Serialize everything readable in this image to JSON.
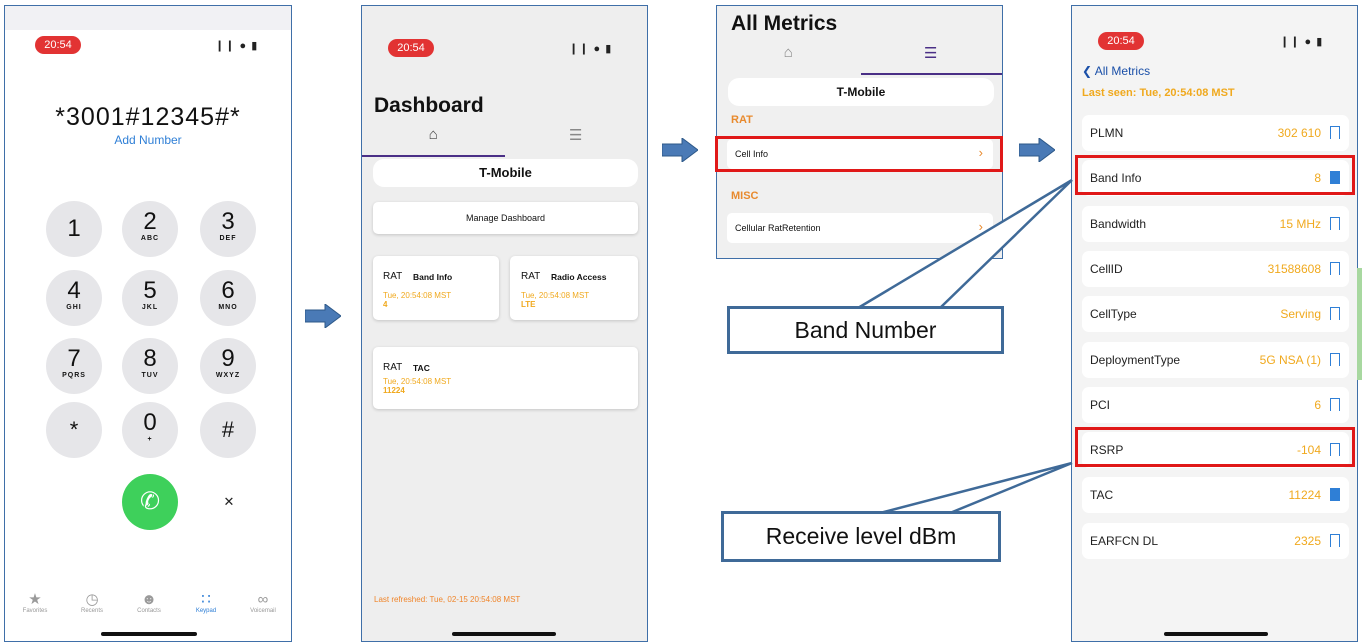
{
  "time": "20:54",
  "status_icons": "❙❙ ● ▮",
  "phone1": {
    "dialed": "*3001#12345#*",
    "add_number": "Add Number",
    "keys": [
      {
        "digit": "1",
        "letters": ""
      },
      {
        "digit": "2",
        "letters": "ABC"
      },
      {
        "digit": "3",
        "letters": "DEF"
      },
      {
        "digit": "4",
        "letters": "GHI"
      },
      {
        "digit": "5",
        "letters": "JKL"
      },
      {
        "digit": "6",
        "letters": "MNO"
      },
      {
        "digit": "7",
        "letters": "PQRS"
      },
      {
        "digit": "8",
        "letters": "TUV"
      },
      {
        "digit": "9",
        "letters": "WXYZ"
      },
      {
        "digit": "*",
        "letters": ""
      },
      {
        "digit": "0",
        "letters": "+"
      },
      {
        "digit": "#",
        "letters": ""
      }
    ],
    "tabs": [
      "Favorites",
      "Recents",
      "Contacts",
      "Keypad",
      "Voicemail"
    ]
  },
  "phone2": {
    "title": "Dashboard",
    "carrier": "T-Mobile",
    "manage_label": "Manage Dashboard",
    "cards": [
      {
        "rat": "RAT",
        "name": "Band Info",
        "time": "Tue, 20:54:08 MST",
        "value": "4"
      },
      {
        "rat": "RAT",
        "name": "Radio Access",
        "time": "Tue, 20:54:08 MST",
        "value": "LTE"
      },
      {
        "rat": "RAT",
        "name": "TAC",
        "time": "Tue, 20:54:08 MST",
        "value": "11224"
      }
    ],
    "refreshed": "Last refreshed: Tue, 02-15 20:54:08 MST"
  },
  "phone3": {
    "title": "All Metrics",
    "carrier": "T-Mobile",
    "sections": [
      {
        "header": "RAT",
        "item": "Cell Info"
      },
      {
        "header": "MISC",
        "item": "Cellular RatRetention"
      }
    ]
  },
  "phone4": {
    "back_label": "All Metrics",
    "last_seen": "Last seen: Tue, 20:54:08 MST",
    "rows": [
      {
        "label": "PLMN",
        "value": "302 610",
        "bookmarked": false
      },
      {
        "label": "Band Info",
        "value": "8",
        "bookmarked": true
      },
      {
        "label": "Bandwidth",
        "value": "15 MHz",
        "bookmarked": false
      },
      {
        "label": "CellID",
        "value": "31588608",
        "bookmarked": false
      },
      {
        "label": "CellType",
        "value": "Serving",
        "bookmarked": false
      },
      {
        "label": "DeploymentType",
        "value": "5G NSA (1)",
        "bookmarked": false
      },
      {
        "label": "PCI",
        "value": "6",
        "bookmarked": false
      },
      {
        "label": "RSRP",
        "value": "-104",
        "bookmarked": false
      },
      {
        "label": "TAC",
        "value": "11224",
        "bookmarked": true
      },
      {
        "label": "EARFCN DL",
        "value": "2325",
        "bookmarked": false
      }
    ]
  },
  "annotations": {
    "band_number": "Band Number",
    "receive_level": "Receive level dBm"
  },
  "colors": {
    "accent_orange": "#f0a91e",
    "highlight_red": "#e01818",
    "arrow_blue": "#4a7ab6",
    "call_green": "#3ed05b"
  }
}
